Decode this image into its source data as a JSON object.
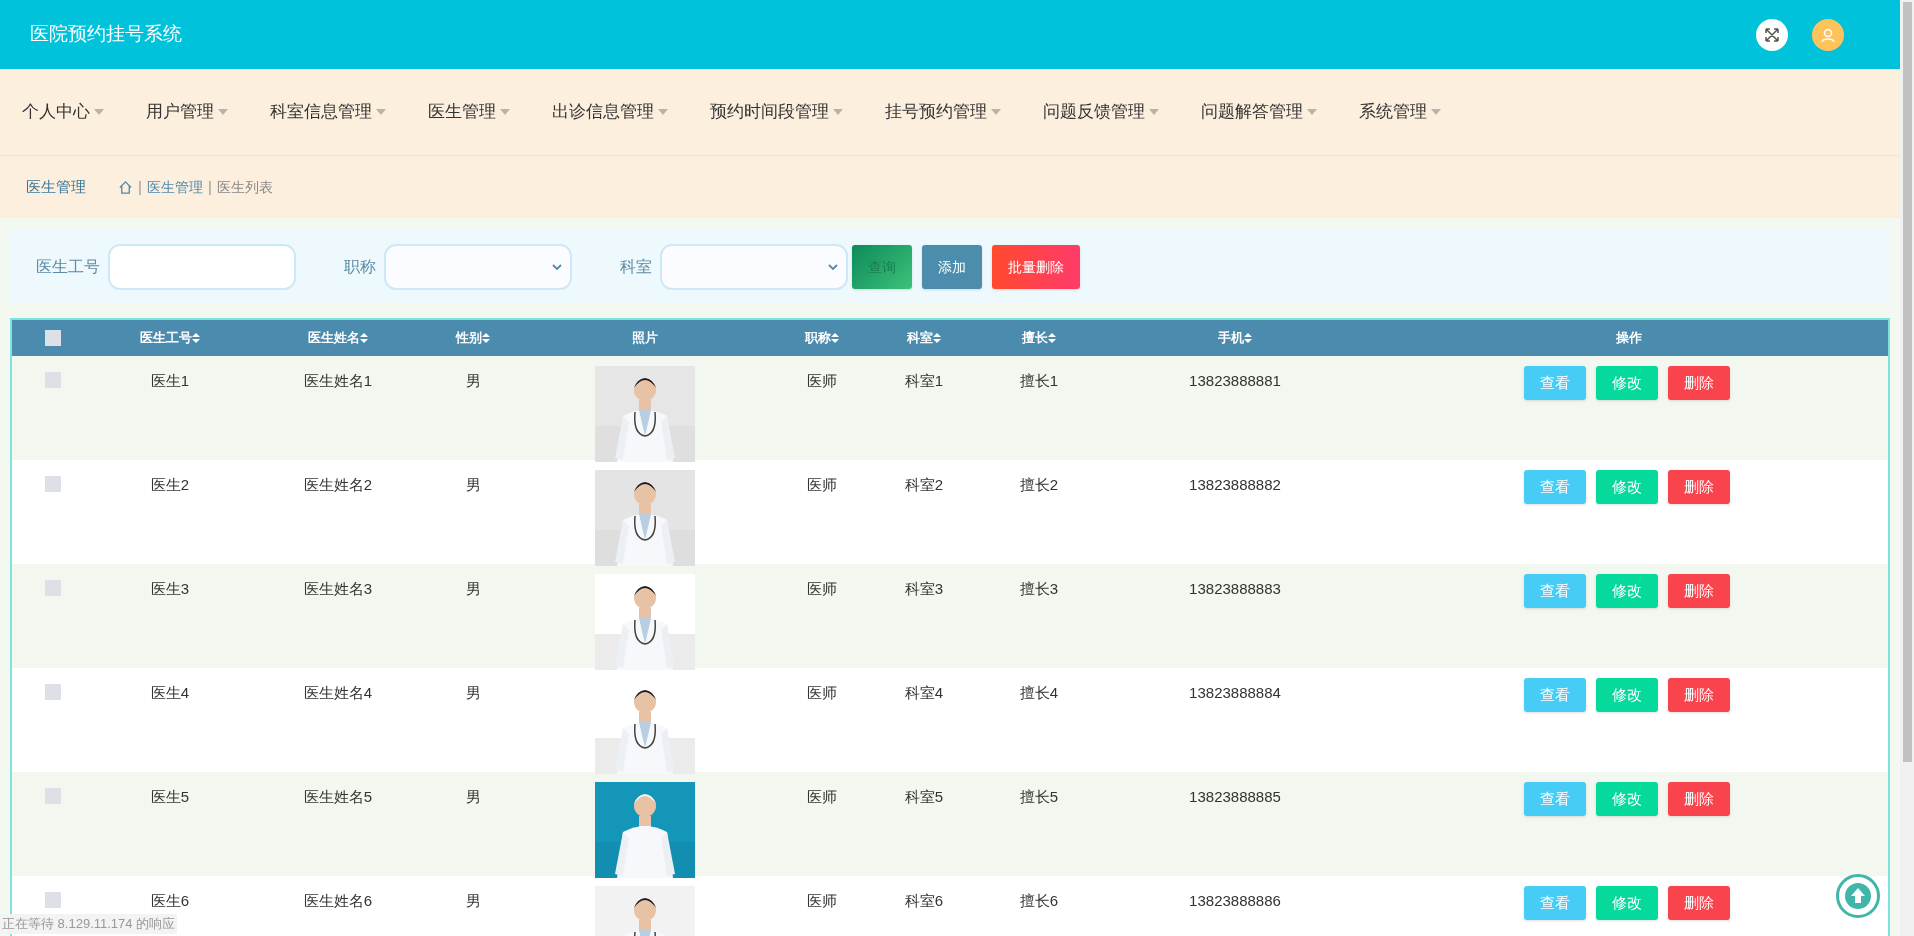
{
  "header": {
    "title": "医院预约挂号系统"
  },
  "nav": [
    {
      "label": "个人中心"
    },
    {
      "label": "用户管理"
    },
    {
      "label": "科室信息管理"
    },
    {
      "label": "医生管理"
    },
    {
      "label": "出诊信息管理"
    },
    {
      "label": "预约时间段管理"
    },
    {
      "label": "挂号预约管理"
    },
    {
      "label": "问题反馈管理"
    },
    {
      "label": "问题解答管理"
    },
    {
      "label": "系统管理"
    }
  ],
  "breadcrumb": {
    "title": "医生管理",
    "separator": "|",
    "path": [
      "医生管理",
      "医生列表"
    ]
  },
  "filters": [
    {
      "kind": "text",
      "label": "医生工号"
    },
    {
      "kind": "select",
      "label": "职称"
    },
    {
      "kind": "select",
      "label": "科室"
    }
  ],
  "buttons": [
    {
      "kind": "search",
      "label": "查询"
    },
    {
      "kind": "add",
      "label": "添加"
    },
    {
      "kind": "delete",
      "label": "批量删除"
    }
  ],
  "table": {
    "select_all": {
      "checked": false
    },
    "columns": [
      {
        "label": "医生工号",
        "sortable": true
      },
      {
        "label": "医生姓名",
        "sortable": true
      },
      {
        "label": "性别",
        "sortable": true
      },
      {
        "label": "照片",
        "sortable": false
      },
      {
        "label": "职称",
        "sortable": true
      },
      {
        "label": "科室",
        "sortable": true
      },
      {
        "label": "擅长",
        "sortable": true
      },
      {
        "label": "手机",
        "sortable": true
      },
      {
        "label": "操作",
        "sortable": false
      }
    ],
    "rows": [
      {
        "checked": false,
        "cells": [
          "医生1",
          "医生姓名1",
          "男"
        ],
        "photo": {
          "kind": "picture"
        },
        "cells_after": [
          "医师",
          "科室1",
          "擅长1",
          "13823888881"
        ],
        "actions": [
          {
            "kind": "view",
            "label": "查看"
          },
          {
            "kind": "edit",
            "label": "修改"
          },
          {
            "kind": "delete",
            "label": "删除"
          }
        ]
      },
      {
        "checked": false,
        "cells": [
          "医生2",
          "医生姓名2",
          "男"
        ],
        "photo": {
          "kind": "picture"
        },
        "cells_after": [
          "医师",
          "科室2",
          "擅长2",
          "13823888882"
        ],
        "actions": [
          {
            "kind": "view",
            "label": "查看"
          },
          {
            "kind": "edit",
            "label": "修改"
          },
          {
            "kind": "delete",
            "label": "删除"
          }
        ]
      },
      {
        "checked": false,
        "cells": [
          "医生3",
          "医生姓名3",
          "男"
        ],
        "photo": {
          "kind": "picture"
        },
        "cells_after": [
          "医师",
          "科室3",
          "擅长3",
          "13823888883"
        ],
        "actions": [
          {
            "kind": "view",
            "label": "查看"
          },
          {
            "kind": "edit",
            "label": "修改"
          },
          {
            "kind": "delete",
            "label": "删除"
          }
        ]
      },
      {
        "checked": false,
        "cells": [
          "医生4",
          "医生姓名4",
          "男"
        ],
        "photo": {
          "kind": "picture"
        },
        "cells_after": [
          "医师",
          "科室4",
          "擅长4",
          "13823888884"
        ],
        "actions": [
          {
            "kind": "view",
            "label": "查看"
          },
          {
            "kind": "edit",
            "label": "修改"
          },
          {
            "kind": "delete",
            "label": "删除"
          }
        ]
      },
      {
        "checked": false,
        "cells": [
          "医生5",
          "医生姓名5",
          "男"
        ],
        "photo": {
          "kind": "picture"
        },
        "cells_after": [
          "医师",
          "科室5",
          "擅长5",
          "13823888885"
        ],
        "actions": [
          {
            "kind": "view",
            "label": "查看"
          },
          {
            "kind": "edit",
            "label": "修改"
          },
          {
            "kind": "delete",
            "label": "删除"
          }
        ]
      },
      {
        "checked": false,
        "cells": [
          "医生6",
          "医生姓名6",
          "男"
        ],
        "photo": {
          "kind": "picture"
        },
        "cells_after": [
          "医师",
          "科室6",
          "擅长6",
          "13823888886"
        ],
        "actions": [
          {
            "kind": "view",
            "label": "查看"
          },
          {
            "kind": "edit",
            "label": "修改"
          },
          {
            "kind": "delete",
            "label": "删除"
          }
        ]
      }
    ]
  },
  "status_bar": "正在等待 8.129.11.174 的响应"
}
